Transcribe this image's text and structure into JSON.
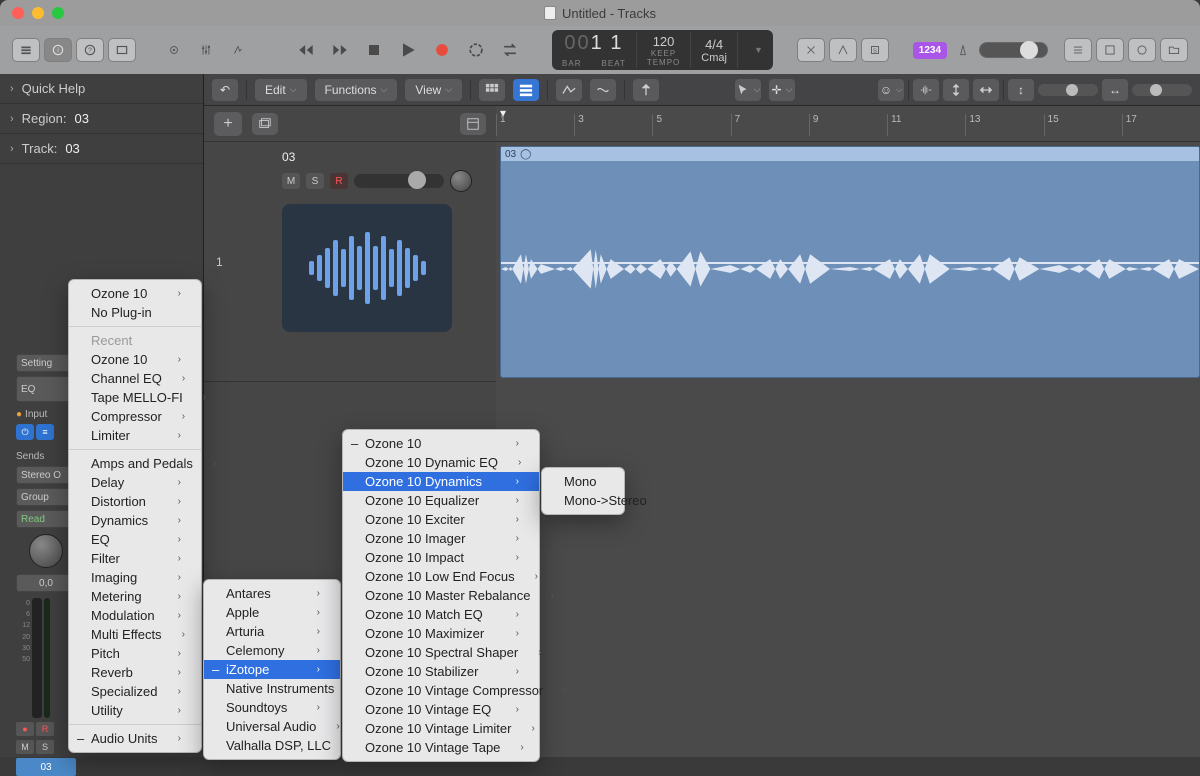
{
  "window": {
    "title": "Untitled - Tracks"
  },
  "lcd": {
    "bars_dim": "00",
    "bars": "1",
    "beat": "1",
    "tempo": "120",
    "tempo_mode": "KEEP",
    "timesig": "4/4",
    "key": "Cmaj",
    "label_bar": "BAR",
    "label_beat": "BEAT",
    "label_tempo": "TEMPO"
  },
  "step_badge": "1234",
  "sidebar": {
    "quick_help": "Quick Help",
    "region_label": "Region:",
    "region_value": "03",
    "track_label": "Track:",
    "track_value": "03"
  },
  "subtoolbar": {
    "edit": "Edit",
    "functions": "Functions",
    "view": "View"
  },
  "ruler": [
    "1",
    "3",
    "5",
    "7",
    "9",
    "11",
    "13",
    "15",
    "17"
  ],
  "track": {
    "number": "1",
    "name": "03",
    "mute": "M",
    "solo": "S",
    "rec": "R"
  },
  "region": {
    "name": "03",
    "marker": "◯"
  },
  "chstrip": {
    "setting": "Setting",
    "eq": "EQ",
    "input": "Input",
    "sends": "Sends",
    "stereo_out": "Stereo O",
    "group": "Group",
    "read": "Read",
    "pan_db": "0,0",
    "m": "M",
    "s": "S",
    "r": "R",
    "name": "03",
    "scale": [
      "0",
      "6",
      "12",
      "20",
      "30",
      "50"
    ]
  },
  "menu1": {
    "items_top": [
      "Ozone 10",
      "No Plug-in"
    ],
    "recent_label": "Recent",
    "recent": [
      "Ozone 10",
      "Channel EQ",
      "Tape MELLO-FI",
      "Compressor",
      "Limiter"
    ],
    "categories": [
      "Amps and Pedals",
      "Delay",
      "Distortion",
      "Dynamics",
      "EQ",
      "Filter",
      "Imaging",
      "Metering",
      "Modulation",
      "Multi Effects",
      "Pitch",
      "Reverb",
      "Specialized",
      "Utility"
    ],
    "au": "Audio Units"
  },
  "menu2": {
    "items": [
      "Antares",
      "Apple",
      "Arturia",
      "Celemony",
      "iZotope",
      "Native Instruments",
      "Soundtoys",
      "Universal Audio",
      "Valhalla DSP, LLC"
    ],
    "selected": "iZotope"
  },
  "menu3": {
    "items": [
      "Ozone 10",
      "Ozone 10 Dynamic EQ",
      "Ozone 10 Dynamics",
      "Ozone 10 Equalizer",
      "Ozone 10 Exciter",
      "Ozone 10 Imager",
      "Ozone 10 Impact",
      "Ozone 10 Low End Focus",
      "Ozone 10 Master Rebalance",
      "Ozone 10 Match EQ",
      "Ozone 10 Maximizer",
      "Ozone 10 Spectral Shaper",
      "Ozone 10 Stabilizer",
      "Ozone 10 Vintage Compressor",
      "Ozone 10 Vintage EQ",
      "Ozone 10 Vintage Limiter",
      "Ozone 10 Vintage Tape"
    ],
    "selected": "Ozone 10 Dynamics",
    "dash_first": true
  },
  "menu4": {
    "items": [
      "Mono",
      "Mono->Stereo"
    ]
  }
}
